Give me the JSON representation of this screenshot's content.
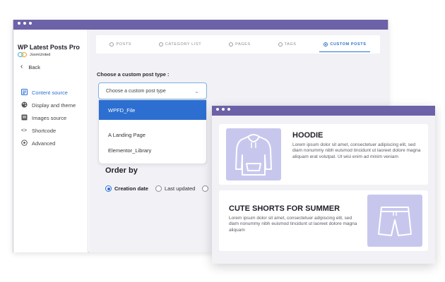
{
  "app": {
    "title": "WP Latest Posts Pro",
    "brand": "JoomUnited"
  },
  "sidebar": {
    "back_label": "Back",
    "items": [
      {
        "label": "Content source",
        "icon": "content-source-icon",
        "active": true
      },
      {
        "label": "Display and theme",
        "icon": "palette-icon",
        "active": false
      },
      {
        "label": "Images source",
        "icon": "image-icon",
        "active": false
      },
      {
        "label": "Shortcode",
        "icon": "code-icon",
        "active": false
      },
      {
        "label": "Advanced",
        "icon": "advanced-icon",
        "active": false
      }
    ]
  },
  "tabs": [
    {
      "label": "POSTS",
      "active": false
    },
    {
      "label": "CATEGORY LIST",
      "active": false
    },
    {
      "label": "PAGES",
      "active": false
    },
    {
      "label": "TAGS",
      "active": false
    },
    {
      "label": "CUSTOM POSTS",
      "active": true
    }
  ],
  "custom_post": {
    "label": "Choose a custom post type :",
    "select_value": "Choose a custom post type",
    "options": [
      "WPFD_File",
      "A Landing Page",
      "Elementor_Library"
    ],
    "highlighted": "WPFD_File"
  },
  "order": {
    "title": "Order by",
    "options": [
      {
        "label": "Creation date",
        "checked": true
      },
      {
        "label": "Last updated",
        "checked": false
      }
    ]
  },
  "preview": {
    "cards": [
      {
        "title": "HOODIE",
        "body": "Lorem ipsum dolor sit amet, consectetuer adipiscing elit, sed diam nonummy nibh euismod tincidunt ut laoreet dolore magna aliquam erat volutpat. Ut wisi enim ad minim veniam"
      },
      {
        "title": "CUTE SHORTS FOR SUMMER",
        "body": "Lorem ipsum dolor sit amet, consectetuer adipiscing elit, sed diam nonummy nibh euismod tincidunt ut laoreet dolore magna aliquam"
      }
    ]
  },
  "colors": {
    "titlebar": "#6b62a8",
    "accent": "#2c6fd1",
    "thumb": "#c7c7ee"
  }
}
